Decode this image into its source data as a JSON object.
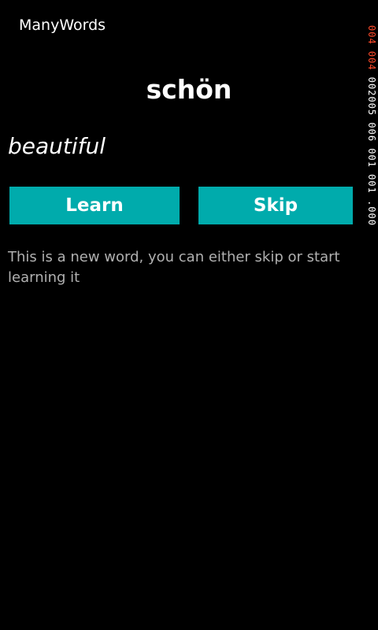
{
  "app": {
    "title": "ManyWords"
  },
  "card": {
    "word": "schön",
    "translation": "beautiful",
    "hint": "This is a new word, you can either skip or start learning it"
  },
  "actions": {
    "learn_label": "Learn",
    "skip_label": "Skip"
  },
  "frame_rate_counter": {
    "red_segment": "004 004",
    "white_segment": " 002005 006 001 001 .000"
  },
  "colors": {
    "background": "#000000",
    "accent": "#00abac",
    "hint_text": "#b0b0b0",
    "counter_red": "#ff4a2a"
  }
}
